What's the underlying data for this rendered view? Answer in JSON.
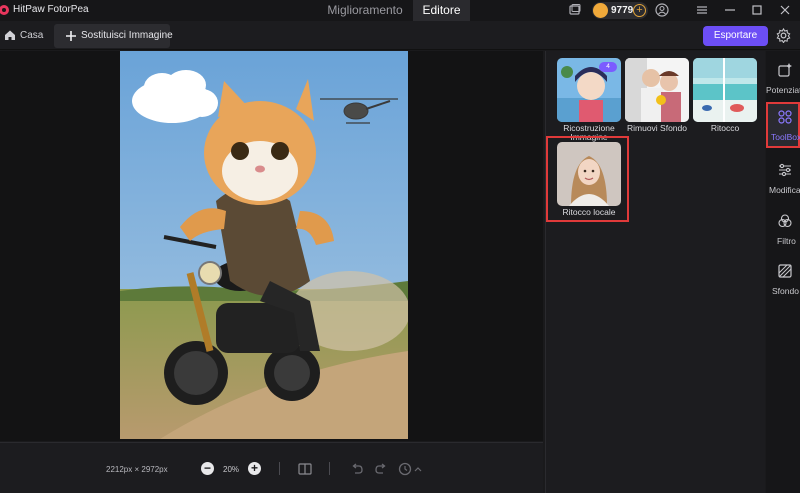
{
  "app": {
    "title": "HitPaw FotorPea"
  },
  "main_tabs": [
    {
      "label": "Miglioramento",
      "active": false
    },
    {
      "label": "Editore",
      "active": true
    }
  ],
  "credits": {
    "value": "9779"
  },
  "toolbar": {
    "home_label": "Casa",
    "replace_label": "Sostituisci Immagine",
    "export_label": "Esportare"
  },
  "canvas": {
    "dimensions": "2212px × 2972px",
    "zoom": "20%"
  },
  "tools": [
    {
      "label": "Ricostruzione Immagine",
      "badge": "4"
    },
    {
      "label": "Rimuovi Sfondo"
    },
    {
      "label": "Ritocco"
    },
    {
      "label": "Ritocco locale"
    }
  ],
  "right_nav": [
    {
      "label": "Potenziatore",
      "icon": "sparkle-icon"
    },
    {
      "label": "ToolBox",
      "icon": "grid-icon",
      "active": true
    },
    {
      "label": "Modifica",
      "icon": "sliders-icon"
    },
    {
      "label": "Filtro",
      "icon": "circles-icon"
    },
    {
      "label": "Sfondo",
      "icon": "hatch-icon"
    }
  ],
  "colors": {
    "accent": "#6c4ef5",
    "highlight": "#e03a3a",
    "background": "#1a1a1c"
  }
}
